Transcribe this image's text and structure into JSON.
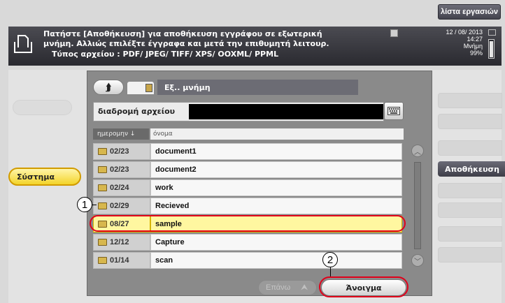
{
  "header": {
    "job_list_label": "λίστα εργασιών",
    "message_line1": "Πατήστε [Αποθήκευση] για αποθήκευση εγγράφου σε εξωτερική",
    "message_line2": "μνήμη. Αλλιώς επιλέξτε έγγραφα και μετά την επιθυμητή λειτουρ.",
    "message_line3": "Τύπος αρχείου        : PDF/ JPEG/ TIFF/ XPS/ OOXML/ PPML",
    "date": "12 / 08/ 2013",
    "time": "14:27",
    "memory_label": "Μνήμη",
    "memory_value": "99%"
  },
  "left_panel": {
    "system_button_label": "Σύστημα"
  },
  "right_panel": {
    "store_button_label": "Αποθήκευση"
  },
  "dialog": {
    "location_label": "Εξ.. μνήμη",
    "path_label": "διαδρομή αρχείου",
    "path_value": "",
    "sort_date_label": "ημερομην  ↓",
    "sort_name_label": "όνομα",
    "files": [
      {
        "date": "02/23",
        "name": "document1"
      },
      {
        "date": "02/23",
        "name": "document2"
      },
      {
        "date": "02/24",
        "name": "work"
      },
      {
        "date": "02/29",
        "name": "Recieved"
      },
      {
        "date": "08/27",
        "name": "sample"
      },
      {
        "date": "12/12",
        "name": "Capture"
      },
      {
        "date": "01/14",
        "name": "scan"
      }
    ],
    "selected_index": 4,
    "page_up_label": "Επάνω",
    "open_button_label": "Άνοιγμα"
  },
  "annotations": {
    "callout_1": "1",
    "callout_2": "2"
  },
  "colors": {
    "selection": "#fff7a0",
    "highlight_outline": "#e0001a",
    "system_button": "#f3d42a"
  }
}
